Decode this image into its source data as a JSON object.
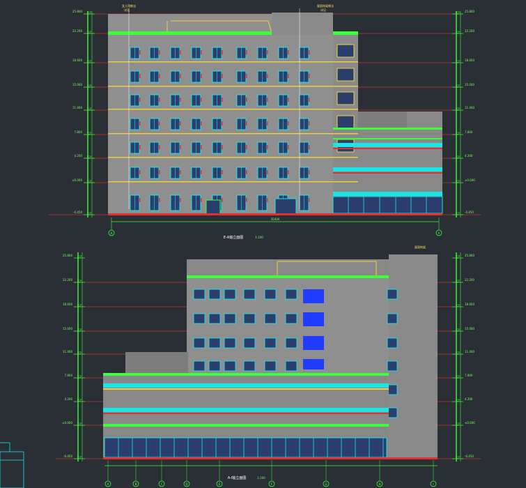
{
  "drawing": {
    "background": "#2a2e35",
    "colors": {
      "wall": "#8f8f8f",
      "wall_dark": "#7a7a7a",
      "window_frame": "#19e6e6",
      "window_pane": "#2c3e6e",
      "green": "#3bff3b",
      "red": "#e03030",
      "yellow": "#f2d23c",
      "blue": "#1f3cff",
      "white": "#ffffff",
      "dim": "#595959"
    }
  },
  "elevation_top": {
    "title": "E-A轴立面图",
    "scale": "1:100",
    "left_axis": "H",
    "right_axis": "A",
    "overall_dim": "35000",
    "roof_notes": [
      "女儿墙做法",
      "详见"
    ],
    "roof_notes_right": [
      "屋面构架做法",
      "详见"
    ]
  },
  "elevation_bottom": {
    "title": "A-I轴立面图",
    "scale": "1:100",
    "axes": [
      "A",
      "B",
      "C",
      "D",
      "E",
      "F",
      "G",
      "H",
      "I"
    ],
    "roof_note": "屋面构架"
  },
  "level_marks": [
    "25.800",
    "22.200",
    "18.600",
    "15.000",
    "11.400",
    "7.800",
    "4.200",
    "±0.000",
    "-0.450"
  ]
}
